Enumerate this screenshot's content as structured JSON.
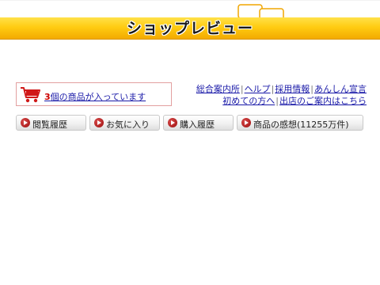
{
  "header": {
    "title": "ショップレビュー"
  },
  "cart": {
    "count": "3",
    "unit": "個",
    "text": "の商品が入っています",
    "icon": "shopping-cart-icon"
  },
  "nav": {
    "row1": [
      "総合案内所",
      "ヘルプ",
      "採用情報",
      "あんしん宣言"
    ],
    "row2": [
      "初めての方へ",
      "出店のご案内はこちら"
    ]
  },
  "buttons": [
    {
      "label": "閲覧履歴"
    },
    {
      "label": "お気に入り"
    },
    {
      "label": "購入履歴"
    },
    {
      "label": "商品の感想(11255万件)"
    }
  ],
  "colors": {
    "header_yellow": "#ffcc12",
    "link_blue": "#1a1aa8",
    "accent_red": "#cc0000"
  }
}
